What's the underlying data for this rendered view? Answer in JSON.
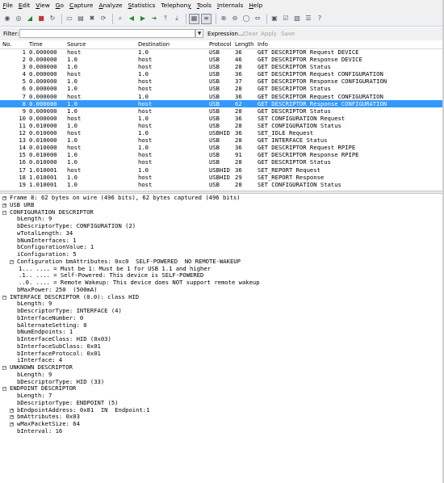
{
  "menu": [
    "File",
    "Edit",
    "View",
    "Go",
    "Capture",
    "Analyze",
    "Statistics",
    "Telephony",
    "Tools",
    "Internals",
    "Help"
  ],
  "menu_underline": [
    "F",
    "E",
    "V",
    "G",
    "C",
    "A",
    "S",
    "y",
    "T",
    "I",
    "H"
  ],
  "toolbar_icons": [
    "interface-list-icon",
    "capture-options-icon",
    "start-capture-icon",
    "stop-capture-icon",
    "restart-capture-icon",
    "sep",
    "open-file-icon",
    "save-file-icon",
    "close-file-icon",
    "reload-icon",
    "sep",
    "find-packet-icon",
    "go-back-icon",
    "go-forward-icon",
    "go-to-packet-icon",
    "go-first-icon",
    "go-last-icon",
    "sep",
    "colorize-icon",
    "autoscroll-icon",
    "sep",
    "zoom-in-icon",
    "zoom-out-icon",
    "zoom-normal-icon",
    "resize-columns-icon",
    "sep",
    "capture-filters-icon",
    "display-filters-icon",
    "coloring-rules-icon",
    "preferences-icon",
    "help-icon"
  ],
  "filter": {
    "label": "Filter:",
    "value": "",
    "expression": "Expression...",
    "clear": "Clear",
    "apply": "Apply",
    "save": "Save"
  },
  "columns": {
    "no": "No.",
    "time": "Time",
    "source": "Source",
    "destination": "Destination",
    "protocol": "Protocol",
    "length": "Length",
    "info": "Info"
  },
  "packets": [
    {
      "no": "1",
      "time": "0.000000",
      "src": "host",
      "dst": "1.0",
      "proto": "USB",
      "len": "36",
      "info": "GET DESCRIPTOR Request DEVICE"
    },
    {
      "no": "2",
      "time": "0.000000",
      "src": "1.0",
      "dst": "host",
      "proto": "USB",
      "len": "46",
      "info": "GET DESCRIPTOR Response DEVICE"
    },
    {
      "no": "3",
      "time": "0.000000",
      "src": "1.0",
      "dst": "host",
      "proto": "USB",
      "len": "28",
      "info": "GET DESCRIPTOR Status"
    },
    {
      "no": "4",
      "time": "0.000000",
      "src": "host",
      "dst": "1.0",
      "proto": "USB",
      "len": "36",
      "info": "GET DESCRIPTOR Request CONFIGURATION"
    },
    {
      "no": "5",
      "time": "0.000000",
      "src": "1.0",
      "dst": "host",
      "proto": "USB",
      "len": "37",
      "info": "GET DESCRIPTOR Response CONFIGURATION"
    },
    {
      "no": "6",
      "time": "0.000000",
      "src": "1.0",
      "dst": "host",
      "proto": "USB",
      "len": "28",
      "info": "GET DESCRIPTOR Status"
    },
    {
      "no": "7",
      "time": "0.000000",
      "src": "host",
      "dst": "1.0",
      "proto": "USB",
      "len": "36",
      "info": "GET DESCRIPTOR Request CONFIGURATION"
    },
    {
      "no": "8",
      "time": "0.000000",
      "src": "1.0",
      "dst": "host",
      "proto": "USB",
      "len": "62",
      "info": "GET DESCRIPTOR Response CONFIGURATION"
    },
    {
      "no": "9",
      "time": "0.000000",
      "src": "1.0",
      "dst": "host",
      "proto": "USB",
      "len": "28",
      "info": "GET DESCRIPTOR Status"
    },
    {
      "no": "10",
      "time": "0.000000",
      "src": "host",
      "dst": "1.0",
      "proto": "USB",
      "len": "36",
      "info": "SET CONFIGURATION Request"
    },
    {
      "no": "11",
      "time": "0.010000",
      "src": "1.0",
      "dst": "host",
      "proto": "USB",
      "len": "28",
      "info": "SET CONFIGURATION Status"
    },
    {
      "no": "12",
      "time": "0.010000",
      "src": "host",
      "dst": "1.0",
      "proto": "USBHID",
      "len": "36",
      "info": "SET_IDLE Request"
    },
    {
      "no": "13",
      "time": "0.010000",
      "src": "1.0",
      "dst": "host",
      "proto": "USB",
      "len": "28",
      "info": "GET INTERFACE Status"
    },
    {
      "no": "14",
      "time": "0.010000",
      "src": "host",
      "dst": "1.0",
      "proto": "USB",
      "len": "36",
      "info": "GET DESCRIPTOR Request RPIPE"
    },
    {
      "no": "15",
      "time": "0.010000",
      "src": "1.0",
      "dst": "host",
      "proto": "USB",
      "len": "91",
      "info": "GET DESCRIPTOR Response RPIPE"
    },
    {
      "no": "16",
      "time": "0.010000",
      "src": "1.0",
      "dst": "host",
      "proto": "USB",
      "len": "28",
      "info": "GET DESCRIPTOR Status"
    },
    {
      "no": "17",
      "time": "1.010001",
      "src": "host",
      "dst": "1.0",
      "proto": "USBHID",
      "len": "36",
      "info": "SET_REPORT Request"
    },
    {
      "no": "18",
      "time": "1.010001",
      "src": "1.0",
      "dst": "host",
      "proto": "USBHID",
      "len": "29",
      "info": "SET_REPORT Response"
    },
    {
      "no": "19",
      "time": "1.010001",
      "src": "1.0",
      "dst": "host",
      "proto": "USB",
      "len": "28",
      "info": "SET CONFIGURATION Status"
    }
  ],
  "selected_packet": "8",
  "selection_color": "#3399ff",
  "details": [
    {
      "level": 0,
      "exp": "+",
      "text": "Frame 8: 62 bytes on wire (496 bits), 62 bytes captured (496 bits)"
    },
    {
      "level": 0,
      "exp": "+",
      "text": "USB URB"
    },
    {
      "level": 0,
      "exp": "-",
      "text": "CONFIGURATION DESCRIPTOR"
    },
    {
      "level": 1,
      "exp": "",
      "text": "bLength: 9"
    },
    {
      "level": 1,
      "exp": "",
      "text": "bDescriptorType: CONFIGURATION (2)"
    },
    {
      "level": 1,
      "exp": "",
      "text": "wTotalLength: 34"
    },
    {
      "level": 1,
      "exp": "",
      "text": "bNumInterfaces: 1"
    },
    {
      "level": 1,
      "exp": "",
      "text": "bConfigurationValue: 1"
    },
    {
      "level": 1,
      "exp": "",
      "text": "iConfiguration: 5"
    },
    {
      "level": 1,
      "exp": "-",
      "text": "Configuration bmAttributes: 0xc0  SELF-POWERED  NO REMOTE-WAKEUP"
    },
    {
      "level": 2,
      "exp": "",
      "text": "1... .... = Must be 1: Must be 1 for USB 1.1 and higher"
    },
    {
      "level": 2,
      "exp": "",
      "text": ".1.. .... = Self-Powered: This device is SELF-POWERED"
    },
    {
      "level": 2,
      "exp": "",
      "text": "..0. .... = Remote Wakeup: This device does NOT support remote wakeup"
    },
    {
      "level": 1,
      "exp": "",
      "text": "bMaxPower: 250  (500mA)"
    },
    {
      "level": 0,
      "exp": "-",
      "text": "INTERFACE DESCRIPTOR (0.0): class HID"
    },
    {
      "level": 1,
      "exp": "",
      "text": "bLength: 9"
    },
    {
      "level": 1,
      "exp": "",
      "text": "bDescriptorType: INTERFACE (4)"
    },
    {
      "level": 1,
      "exp": "",
      "text": "bInterfaceNumber: 0"
    },
    {
      "level": 1,
      "exp": "",
      "text": "bAlternateSetting: 0"
    },
    {
      "level": 1,
      "exp": "",
      "text": "bNumEndpoints: 1"
    },
    {
      "level": 1,
      "exp": "",
      "text": "bInterfaceClass: HID (0x03)"
    },
    {
      "level": 1,
      "exp": "",
      "text": "bInterfaceSubClass: 0x01"
    },
    {
      "level": 1,
      "exp": "",
      "text": "bInterfaceProtocol: 0x01"
    },
    {
      "level": 1,
      "exp": "",
      "text": "iInterface: 4"
    },
    {
      "level": 0,
      "exp": "-",
      "text": "UNKNOWN DESCRIPTOR"
    },
    {
      "level": 1,
      "exp": "",
      "text": "bLength: 9"
    },
    {
      "level": 1,
      "exp": "",
      "text": "bDescriptorType: HID (33)"
    },
    {
      "level": 0,
      "exp": "-",
      "text": "ENDPOINT DESCRIPTOR"
    },
    {
      "level": 1,
      "exp": "",
      "text": "bLength: 7"
    },
    {
      "level": 1,
      "exp": "",
      "text": "bDescriptorType: ENDPOINT (5)"
    },
    {
      "level": 1,
      "exp": "+",
      "text": "bEndpointAddress: 0x81  IN  Endpoint:1"
    },
    {
      "level": 1,
      "exp": "+",
      "text": "bmAttributes: 0x03"
    },
    {
      "level": 1,
      "exp": "+",
      "text": "wMaxPacketSize: 64"
    },
    {
      "level": 1,
      "exp": "",
      "text": "bInterval: 16"
    }
  ]
}
